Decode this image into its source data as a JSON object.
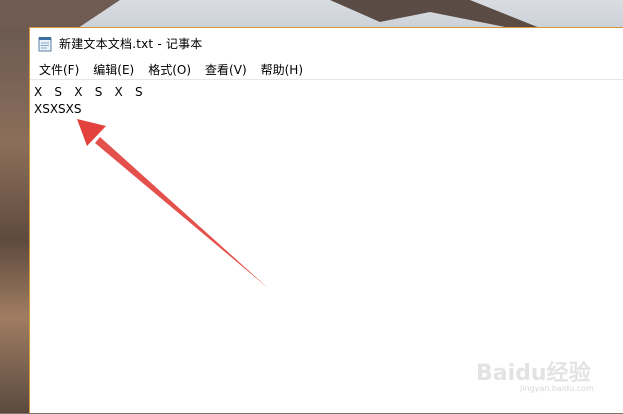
{
  "window": {
    "title": "新建文本文档.txt - 记事本",
    "accent_border": "#d39a3a"
  },
  "menu": {
    "items": [
      {
        "label": "文件(F)"
      },
      {
        "label": "编辑(E)"
      },
      {
        "label": "格式(O)"
      },
      {
        "label": "查看(V)"
      },
      {
        "label": "帮助(H)"
      }
    ]
  },
  "editor": {
    "lines": [
      "X S X S X S",
      "XSXSXS"
    ]
  },
  "annotation": {
    "arrow_color": "#e2413c"
  },
  "watermark": {
    "text": "Baidu经验",
    "sub": "jingyan.baidu.com"
  }
}
